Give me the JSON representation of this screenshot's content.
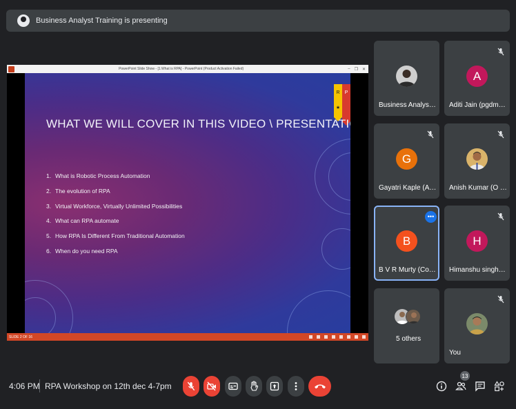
{
  "banner": {
    "text": "Business Analyst Training is presenting"
  },
  "powerpoint": {
    "window_title": "PowerPoint Slide Show - [1.What is RPA] - PowerPoint (Product Activation Failed)",
    "status_text": "SLIDE 2 OF 16"
  },
  "slide": {
    "title": "WHAT WE WILL COVER IN THIS VIDEO \\ PRESENTATION",
    "logo_letters": [
      "R",
      "P",
      "A"
    ],
    "items": [
      {
        "num": "1.",
        "text": "What is Robotic Process Automation"
      },
      {
        "num": "2.",
        "text": "The evolution of RPA"
      },
      {
        "num": "3.",
        "text": "Virtual Workforce, Virtually Unlimited Possibilities"
      },
      {
        "num": "4.",
        "text": "What can RPA automate"
      },
      {
        "num": "5.",
        "text": "How  RPA Is Different From Traditional Automation"
      },
      {
        "num": "6.",
        "text": "When do you need RPA"
      }
    ]
  },
  "participants": [
    {
      "name": "Business Analyst Tr...",
      "avatar": "photo",
      "muted": false
    },
    {
      "name": "Aditi Jain (pgdm 2...",
      "initial": "A",
      "color": "#c2185b",
      "muted": true
    },
    {
      "name": "Gayatri Kaple (Ass...",
      "initial": "G",
      "color": "#e8710a",
      "muted": true
    },
    {
      "name": "Anish Kumar (O &...",
      "avatar": "photo",
      "muted": true
    },
    {
      "name": "B V R Murty (Cons...",
      "initial": "B",
      "color": "#f4511e",
      "muted": false,
      "active": true
    },
    {
      "name": "Himanshu singh (O...",
      "initial": "H",
      "color": "#c2185b",
      "muted": true
    },
    {
      "name": "5 others",
      "avatar": "group"
    },
    {
      "name": "You",
      "avatar": "photo",
      "muted": true
    }
  ],
  "bottom_bar": {
    "time": "4:06 PM",
    "meeting_title": "RPA Workshop on 12th dec 4-7pm",
    "participant_count": "13"
  },
  "icons": {
    "mic": "mic-off-icon",
    "cam": "camera-off-icon",
    "captions": "captions-icon",
    "hand": "raise-hand-icon",
    "present": "present-icon",
    "more": "more-options-icon",
    "end": "end-call-icon",
    "info": "info-icon",
    "people": "people-icon",
    "chat": "chat-icon",
    "activities": "activities-icon"
  }
}
